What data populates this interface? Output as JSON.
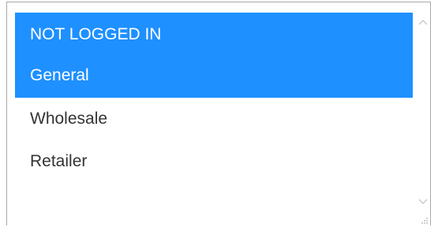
{
  "listbox": {
    "options": [
      {
        "label": "NOT LOGGED IN",
        "selected": true
      },
      {
        "label": "General",
        "selected": true
      },
      {
        "label": "Wholesale",
        "selected": false
      },
      {
        "label": "Retailer",
        "selected": false
      }
    ]
  },
  "scrollbar": {
    "up_icon": "chevron-up-icon",
    "down_icon": "chevron-down-icon"
  },
  "colors": {
    "selection": "#1e90ff",
    "border": "#a9a9a9",
    "text": "#333333"
  }
}
